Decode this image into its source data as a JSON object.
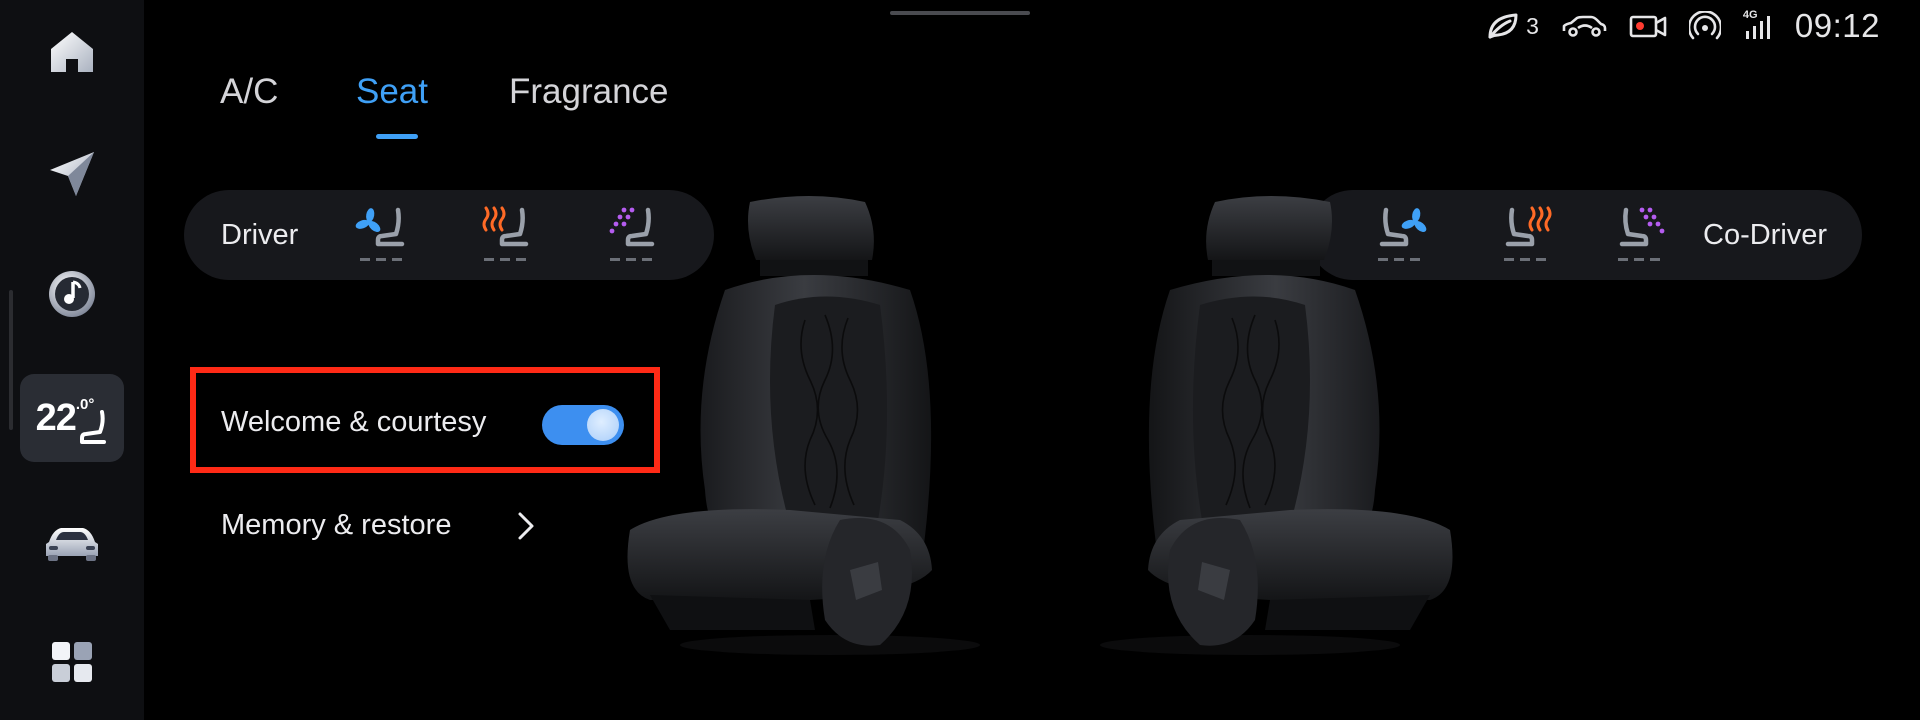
{
  "dock": {
    "items": [
      {
        "name": "home",
        "icon": "home-icon"
      },
      {
        "name": "navigation",
        "icon": "navigation-arrow-icon"
      },
      {
        "name": "music",
        "icon": "music-disc-icon"
      },
      {
        "name": "climate",
        "icon": "seat-climate-icon",
        "temp": "22",
        "temp_decimal": ".0°",
        "active": true
      },
      {
        "name": "vehicle",
        "icon": "car-icon"
      },
      {
        "name": "apps",
        "icon": "apps-grid-icon"
      }
    ]
  },
  "status_bar": {
    "eco_count": "3",
    "network": "4G",
    "time": "09:12",
    "icons": [
      "eco-leaf-icon",
      "car-status-icon",
      "dashcam-icon",
      "hotspot-icon",
      "signal-4g-icon"
    ]
  },
  "tabs": [
    {
      "label": "A/C",
      "active": false
    },
    {
      "label": "Seat",
      "active": true
    },
    {
      "label": "Fragrance",
      "active": false
    }
  ],
  "driver": {
    "label": "Driver",
    "controls": [
      {
        "type": "ventilation",
        "icon": "seat-ventilation-icon",
        "color": "#3fa0f6",
        "level": 0
      },
      {
        "type": "heating",
        "icon": "seat-heating-icon",
        "color": "#ff6a26",
        "level": 0
      },
      {
        "type": "massage",
        "icon": "seat-massage-icon",
        "color": "#b55cf0",
        "level": 0
      }
    ]
  },
  "co_driver": {
    "label": "Co-Driver",
    "controls": [
      {
        "type": "ventilation",
        "icon": "seat-ventilation-icon",
        "color": "#3fa0f6",
        "level": 0
      },
      {
        "type": "heating",
        "icon": "seat-heating-icon",
        "color": "#ff6a26",
        "level": 0
      },
      {
        "type": "massage",
        "icon": "seat-massage-icon",
        "color": "#b55cf0",
        "level": 0
      }
    ]
  },
  "options": {
    "welcome_label": "Welcome & courtesy",
    "welcome_enabled": true,
    "memory_label": "Memory & restore"
  },
  "colors": {
    "accent": "#3fa0f6",
    "highlight": "#ff2a16",
    "background": "#000000"
  }
}
